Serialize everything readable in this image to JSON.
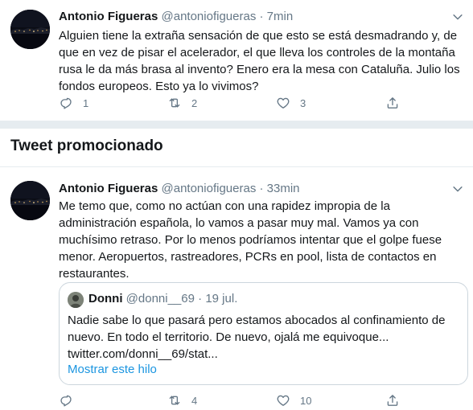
{
  "tweets": [
    {
      "name": "Antonio Figueras",
      "handle": "@antoniofigueras",
      "separator": "·",
      "time": "7min",
      "lines": [
        "Alguien tiene la extraña sensación de que esto se está desmadrando y, de",
        "que en vez de pisar el acelerador, el que lleva los controles de la montaña",
        "rusa le da más brasa al invento? Enero era la mesa con Cataluña. Julio los",
        "fondos europeos. Esto ya lo vivimos?"
      ],
      "replies": "1",
      "retweets": "2",
      "likes": "3"
    },
    {
      "name": "Antonio Figueras",
      "handle": "@antoniofigueras",
      "separator": "·",
      "time": "33min",
      "lines": [
        "Me temo que, como no actúan con una rapidez impropia de la",
        "administración española, lo vamos a pasar muy mal. Vamos ya con",
        "muchísimo retraso. Por lo menos podríamos intentar que el golpe fuese",
        "menor. Aeropuertos, rastreadores, PCRs en pool, lista de contactos en",
        "restaurantes."
      ],
      "replies": "",
      "retweets": "4",
      "likes": "10",
      "quote": {
        "name": "Donni",
        "handle": "@donni__69",
        "separator": "·",
        "date": "19 jul.",
        "lines": [
          "Nadie sabe lo que pasará pero estamos abocados al confinamiento de",
          "nuevo. En todo el territorio. De nuevo, ojalá me equivoque...",
          "twitter.com/donni__69/stat..."
        ],
        "show_thread": "Mostrar este hilo"
      }
    }
  ],
  "promoted_header": "Tweet promocionado",
  "colors": {
    "text": "#14171a",
    "secondary": "#657786",
    "link": "#1b95e0",
    "separator": "#e6ecf0"
  },
  "icons": [
    "reply-icon",
    "retweet-icon",
    "like-icon",
    "share-icon",
    "chevron-down-icon"
  ]
}
